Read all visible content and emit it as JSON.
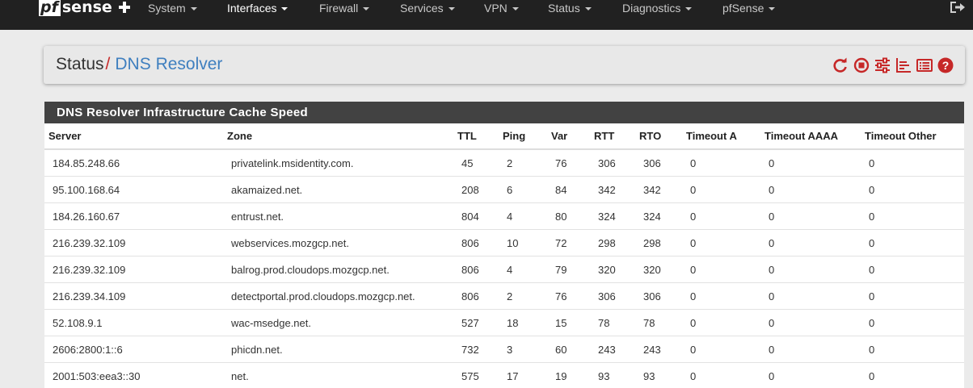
{
  "navbar": {
    "brand_prefix": "pf",
    "brand_suffix": "sense",
    "items": [
      "System",
      "Interfaces",
      "Firewall",
      "Services",
      "VPN",
      "Status",
      "Diagnostics",
      "pfSense"
    ],
    "logout_icon": "sign-out-icon"
  },
  "breadcrumb": {
    "section": "Status",
    "separator": "/",
    "page": "DNS Resolver",
    "icons": [
      "restart-icon",
      "stop-icon",
      "settings-sliders-icon",
      "chart-icon",
      "log-list-icon",
      "help-icon"
    ]
  },
  "colors": {
    "accent_red": "#c62828",
    "link_blue": "#3f7fbf",
    "navbar": "#212121",
    "panel_heading": "#424242"
  },
  "panel": {
    "title": "DNS Resolver Infrastructure Cache Speed",
    "columns": [
      "Server",
      "Zone",
      "TTL",
      "Ping",
      "Var",
      "RTT",
      "RTO",
      "Timeout A",
      "Timeout AAAA",
      "Timeout Other"
    ],
    "rows": [
      [
        "184.85.248.66",
        "privatelink.msidentity.com.",
        "45",
        "2",
        "76",
        "306",
        "306",
        "0",
        "0",
        "0"
      ],
      [
        "95.100.168.64",
        "akamaized.net.",
        "208",
        "6",
        "84",
        "342",
        "342",
        "0",
        "0",
        "0"
      ],
      [
        "184.26.160.67",
        "entrust.net.",
        "804",
        "4",
        "80",
        "324",
        "324",
        "0",
        "0",
        "0"
      ],
      [
        "216.239.32.109",
        "webservices.mozgcp.net.",
        "806",
        "10",
        "72",
        "298",
        "298",
        "0",
        "0",
        "0"
      ],
      [
        "216.239.32.109",
        "balrog.prod.cloudops.mozgcp.net.",
        "806",
        "4",
        "79",
        "320",
        "320",
        "0",
        "0",
        "0"
      ],
      [
        "216.239.34.109",
        "detectportal.prod.cloudops.mozgcp.net.",
        "806",
        "2",
        "76",
        "306",
        "306",
        "0",
        "0",
        "0"
      ],
      [
        "52.108.9.1",
        "wac-msedge.net.",
        "527",
        "18",
        "15",
        "78",
        "78",
        "0",
        "0",
        "0"
      ],
      [
        "2606:2800:1::6",
        "phicdn.net.",
        "732",
        "3",
        "60",
        "243",
        "243",
        "0",
        "0",
        "0"
      ],
      [
        "2001:503:eea3::30",
        "net.",
        "575",
        "17",
        "19",
        "93",
        "93",
        "0",
        "0",
        "0"
      ]
    ]
  }
}
